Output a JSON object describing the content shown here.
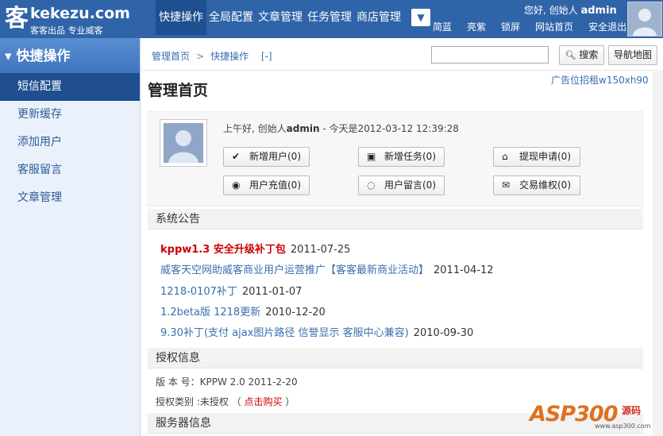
{
  "header": {
    "logo_mark": "客",
    "logo_main": "kekezu.com",
    "logo_sub": "客客出品 专业威客",
    "nav": [
      "快捷操作",
      "全局配置",
      "文章管理",
      "任务管理",
      "商店管理"
    ],
    "more_glyph": "▼",
    "greeting": "您好, 创始人",
    "username": "admin",
    "links": [
      "简蓝",
      "亮紫",
      "锁屏",
      "网站首页",
      "安全退出"
    ]
  },
  "sidebar": {
    "title": "快捷操作",
    "title_icon": "▾",
    "items": [
      "短信配置",
      "更新缓存",
      "添加用户",
      "客服留言",
      "文章管理"
    ]
  },
  "breadcrumb": {
    "home": "管理首页",
    "sep": ">",
    "current": "快捷操作",
    "toggle": "[-]"
  },
  "search": {
    "placeholder": "",
    "button": "搜索",
    "sitemap": "导航地图"
  },
  "ad_text": "广告位招租w150xh90",
  "page_title": "管理首页",
  "welcome": {
    "greet": "上午好, 创始人",
    "user": "admin",
    "date_text": " - 今天是2012-03-12 12:39:28"
  },
  "quick_buttons": [
    {
      "label": "新增用户(0)",
      "icon": "✔",
      "icon_name": "check-icon"
    },
    {
      "label": "新增任务(0)",
      "icon": "▣",
      "icon_name": "task-icon"
    },
    {
      "label": "提现申请(0)",
      "icon": "⌂",
      "icon_name": "home-icon"
    },
    {
      "label": "用户充值(0)",
      "icon": "◉",
      "icon_name": "rss-icon"
    },
    {
      "label": "用户留言(0)",
      "icon": "◌",
      "icon_name": "comment-icon"
    },
    {
      "label": "交易维权(0)",
      "icon": "✉",
      "icon_name": "mail-icon"
    }
  ],
  "announcements": {
    "title": "系统公告",
    "items": [
      {
        "title": "kppw1.3 安全升级补丁包",
        "date": "2011-07-25"
      },
      {
        "title": "威客天空网助威客商业用户运营推广【客客最新商业活动】",
        "date": "2011-04-12"
      },
      {
        "title": "1218-0107补丁",
        "date": "2011-01-07"
      },
      {
        "title": "1.2beta版 1218更新",
        "date": "2010-12-20"
      },
      {
        "title": "9.30补丁(支付 ajax图片路径 信誉显示 客服中心兼容)",
        "date": "2010-09-30"
      }
    ]
  },
  "license": {
    "title": "授权信息",
    "version": "版 本 号：KPPW 2.0 2011-2-20",
    "type_prefix": "授权类别 :未授权 （",
    "buy": "点击购买",
    "type_suffix": "）"
  },
  "server": {
    "title": "服务器信息"
  },
  "watermark": {
    "brand": "ASP300",
    "sub": "源码",
    "url": "www.asp300.com"
  },
  "colors": {
    "header_bg": "#2f64a8",
    "active_bg": "#1f4f90",
    "link": "#3a6fb0",
    "hot": "#cc0000"
  }
}
